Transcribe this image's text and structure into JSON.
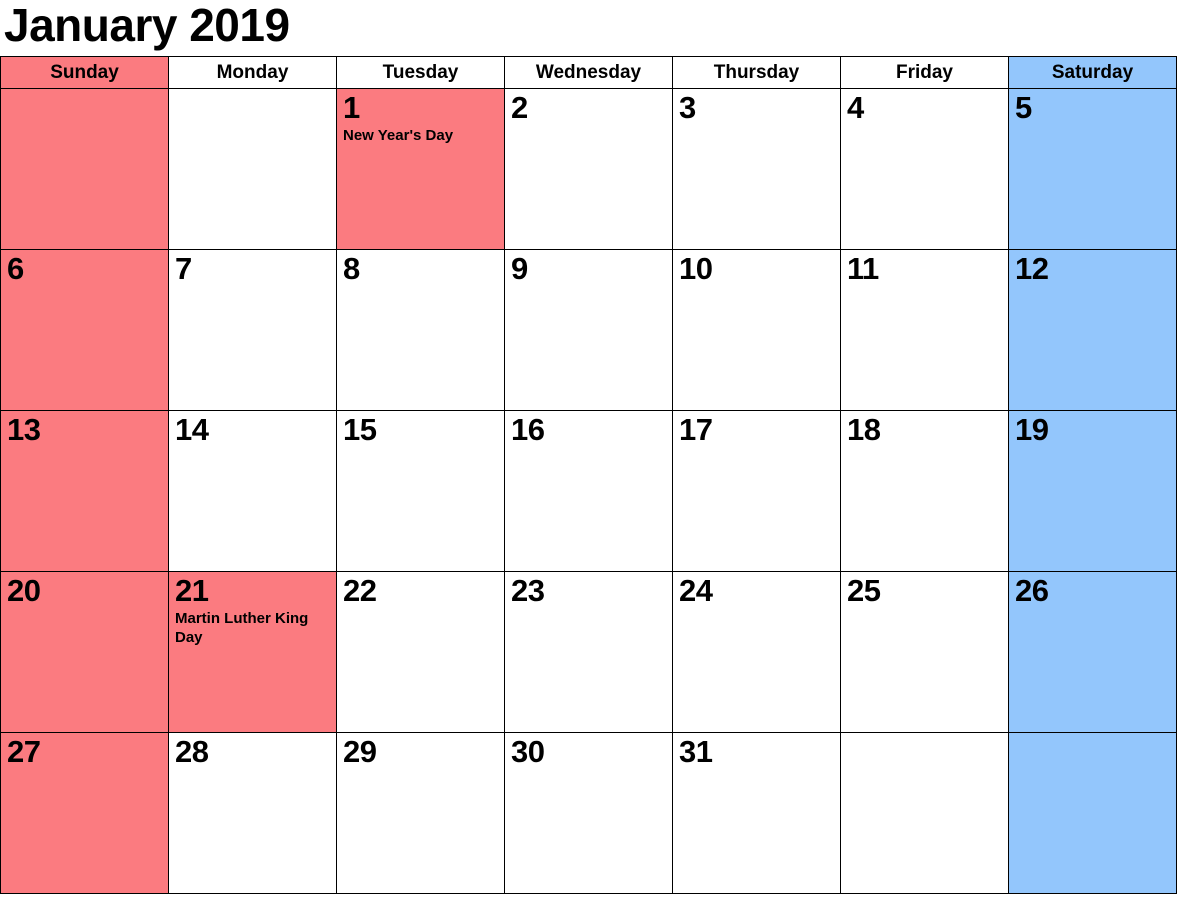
{
  "title": "January 2019",
  "colors": {
    "sunday": "#fb7b80",
    "saturday": "#93c6fc",
    "holiday": "#fb7b80",
    "plain": "#ffffff",
    "grid": "#000000",
    "text": "#000000"
  },
  "weekday_headers": [
    {
      "label": "Sunday",
      "fill": "sunday"
    },
    {
      "label": "Monday",
      "fill": "plain"
    },
    {
      "label": "Tuesday",
      "fill": "plain"
    },
    {
      "label": "Wednesday",
      "fill": "plain"
    },
    {
      "label": "Thursday",
      "fill": "plain"
    },
    {
      "label": "Friday",
      "fill": "plain"
    },
    {
      "label": "Saturday",
      "fill": "saturday"
    }
  ],
  "weeks": [
    [
      {
        "day": "",
        "holiday": "",
        "fill": "sunday"
      },
      {
        "day": "",
        "holiday": "",
        "fill": "plain"
      },
      {
        "day": "1",
        "holiday": "New Year's Day",
        "fill": "holiday"
      },
      {
        "day": "2",
        "holiday": "",
        "fill": "plain"
      },
      {
        "day": "3",
        "holiday": "",
        "fill": "plain"
      },
      {
        "day": "4",
        "holiday": "",
        "fill": "plain"
      },
      {
        "day": "5",
        "holiday": "",
        "fill": "saturday"
      }
    ],
    [
      {
        "day": "6",
        "holiday": "",
        "fill": "sunday"
      },
      {
        "day": "7",
        "holiday": "",
        "fill": "plain"
      },
      {
        "day": "8",
        "holiday": "",
        "fill": "plain"
      },
      {
        "day": "9",
        "holiday": "",
        "fill": "plain"
      },
      {
        "day": "10",
        "holiday": "",
        "fill": "plain"
      },
      {
        "day": "11",
        "holiday": "",
        "fill": "plain"
      },
      {
        "day": "12",
        "holiday": "",
        "fill": "saturday"
      }
    ],
    [
      {
        "day": "13",
        "holiday": "",
        "fill": "sunday"
      },
      {
        "day": "14",
        "holiday": "",
        "fill": "plain"
      },
      {
        "day": "15",
        "holiday": "",
        "fill": "plain"
      },
      {
        "day": "16",
        "holiday": "",
        "fill": "plain"
      },
      {
        "day": "17",
        "holiday": "",
        "fill": "plain"
      },
      {
        "day": "18",
        "holiday": "",
        "fill": "plain"
      },
      {
        "day": "19",
        "holiday": "",
        "fill": "saturday"
      }
    ],
    [
      {
        "day": "20",
        "holiday": "",
        "fill": "sunday"
      },
      {
        "day": "21",
        "holiday": "Martin Luther King Day",
        "fill": "holiday"
      },
      {
        "day": "22",
        "holiday": "",
        "fill": "plain"
      },
      {
        "day": "23",
        "holiday": "",
        "fill": "plain"
      },
      {
        "day": "24",
        "holiday": "",
        "fill": "plain"
      },
      {
        "day": "25",
        "holiday": "",
        "fill": "plain"
      },
      {
        "day": "26",
        "holiday": "",
        "fill": "saturday"
      }
    ],
    [
      {
        "day": "27",
        "holiday": "",
        "fill": "sunday"
      },
      {
        "day": "28",
        "holiday": "",
        "fill": "plain"
      },
      {
        "day": "29",
        "holiday": "",
        "fill": "plain"
      },
      {
        "day": "30",
        "holiday": "",
        "fill": "plain"
      },
      {
        "day": "31",
        "holiday": "",
        "fill": "plain"
      },
      {
        "day": "",
        "holiday": "",
        "fill": "plain"
      },
      {
        "day": "",
        "holiday": "",
        "fill": "saturday"
      }
    ]
  ]
}
